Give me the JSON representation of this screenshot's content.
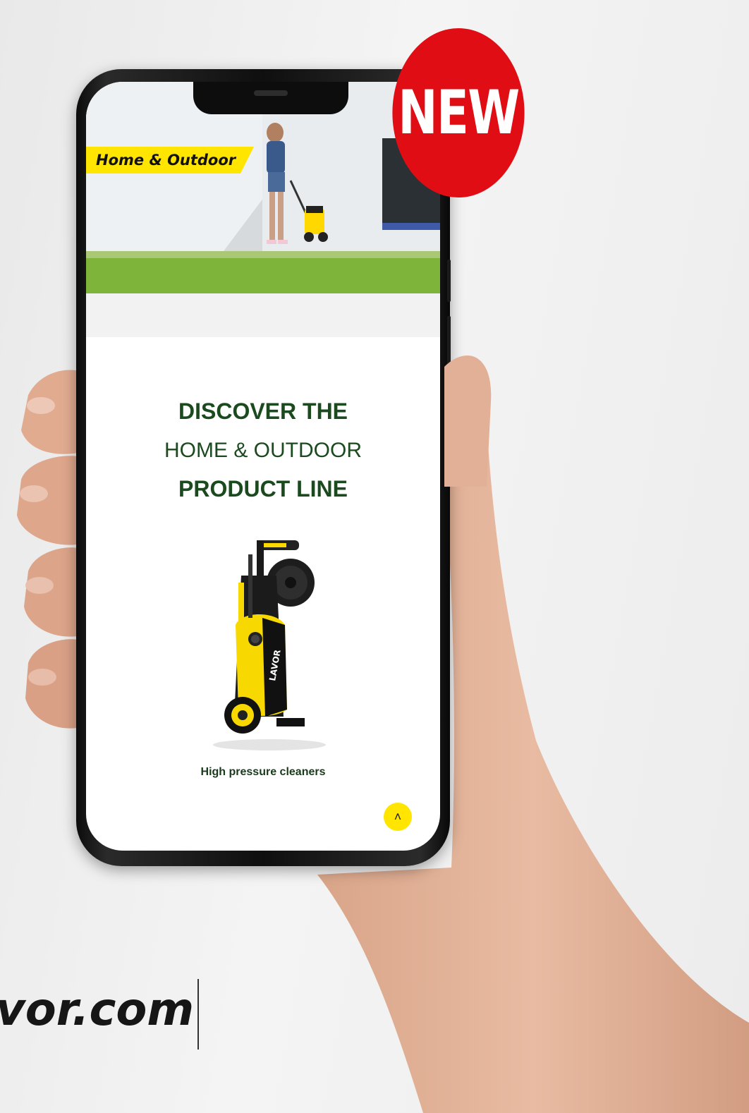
{
  "badge": {
    "label": "NEW"
  },
  "screen": {
    "category_tag": "Home & Outdoor",
    "headline": {
      "line1": "DISCOVER THE",
      "line2": "HOME & OUTDOOR",
      "line3": "PRODUCT LINE"
    },
    "product": {
      "label": "High pressure cleaners",
      "brand_mark": "LAVOR"
    },
    "scroll_top_icon": "chevron-up-icon"
  },
  "footer": {
    "site_text": "vor.com"
  },
  "colors": {
    "accent_yellow": "#ffe500",
    "headline_green": "#1c4a1f",
    "badge_red": "#e00e14"
  }
}
